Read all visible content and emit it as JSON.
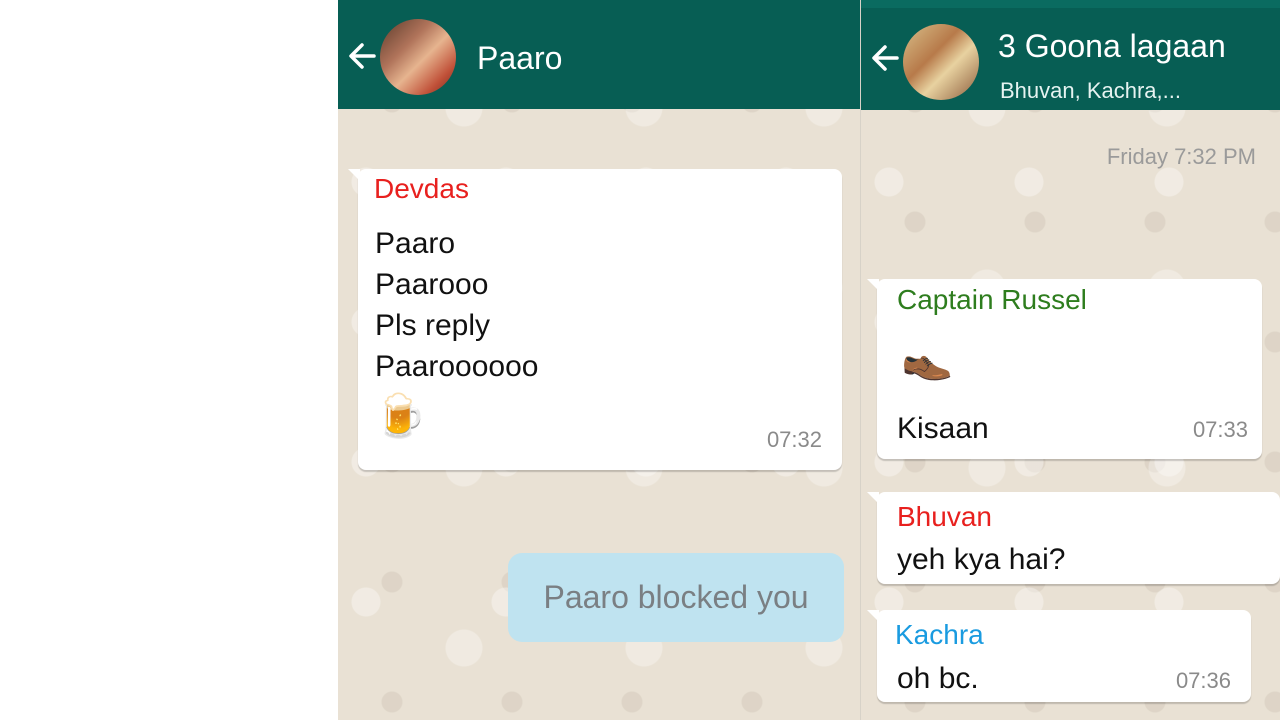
{
  "left_chat": {
    "title": "Paaro",
    "back_icon": "arrow-left-icon",
    "message": {
      "sender": "Devdas",
      "lines": [
        "Paaro",
        "Paarooo",
        "Pls reply",
        "Paaroooooo"
      ],
      "emoji": "🍺",
      "time": "07:32"
    },
    "system_note": "Paaro blocked you"
  },
  "right_chat": {
    "title": "3 Goona lagaan",
    "subtitle": "Bhuvan, Kachra,...",
    "back_icon": "arrow-left-icon",
    "date_label": "Friday 7:32 PM",
    "messages": [
      {
        "sender": "Captain Russel",
        "emoji": "👞",
        "text": "Kisaan",
        "time": "07:33"
      },
      {
        "sender": "Bhuvan",
        "text": "yeh kya hai?"
      },
      {
        "sender": "Kachra",
        "text": "oh bc.",
        "time": "07:36"
      }
    ]
  },
  "colors": {
    "header": "#075e54",
    "chat_background": "#e9e1d4",
    "system_note_bg": "#bfe3f0",
    "sender_red": "#e8201e",
    "sender_green": "#2e7d1e",
    "sender_blue": "#1a9be0"
  }
}
